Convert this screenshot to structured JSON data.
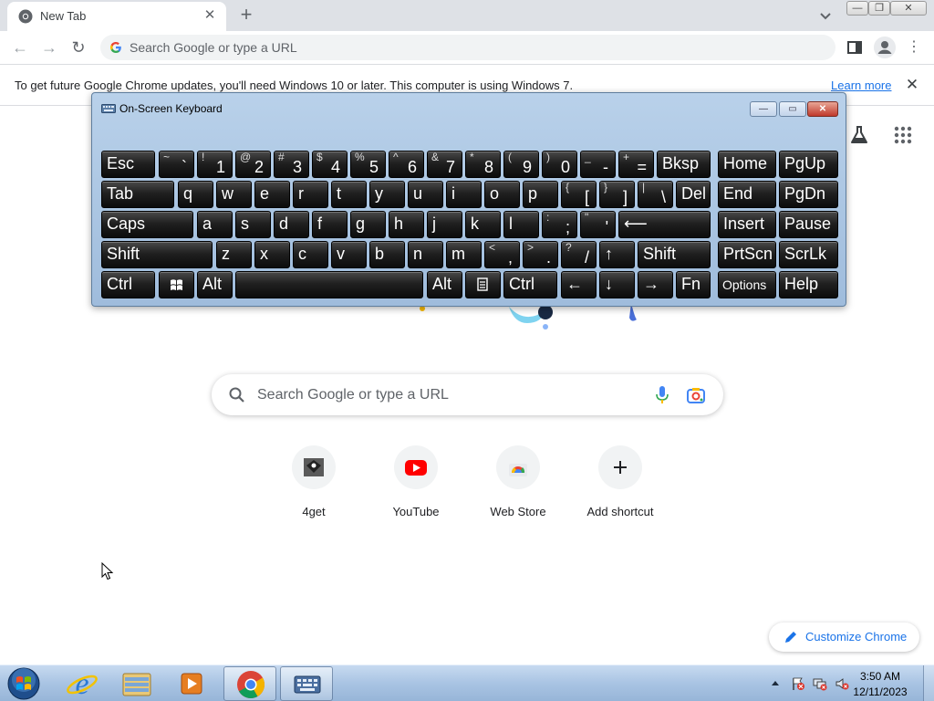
{
  "browser": {
    "tab_title": "New Tab",
    "omnibox_placeholder": "Search Google or type a URL"
  },
  "infobar": {
    "message": "To get future Google Chrome updates, you'll need Windows 10 or later. This computer is using Windows 7.",
    "link_label": "Learn more"
  },
  "ntp": {
    "search_placeholder": "Search Google or type a URL",
    "shortcuts": [
      {
        "label": "4get",
        "icon": "4get-icon"
      },
      {
        "label": "YouTube",
        "icon": "youtube-icon"
      },
      {
        "label": "Web Store",
        "icon": "web-store-icon"
      },
      {
        "label": "Add shortcut",
        "icon": "plus-icon"
      }
    ],
    "customize_label": "Customize Chrome"
  },
  "osk": {
    "title": "On-Screen Keyboard",
    "rows": [
      [
        {
          "main": "Esc"
        },
        {
          "shift": "~",
          "big": "`"
        },
        {
          "shift": "!",
          "big": "1"
        },
        {
          "shift": "@",
          "big": "2"
        },
        {
          "shift": "#",
          "big": "3"
        },
        {
          "shift": "$",
          "big": "4"
        },
        {
          "shift": "%",
          "big": "5"
        },
        {
          "shift": "^",
          "big": "6"
        },
        {
          "shift": "&",
          "big": "7"
        },
        {
          "shift": "*",
          "big": "8"
        },
        {
          "shift": "(",
          "big": "9"
        },
        {
          "shift": ")",
          "big": "0"
        },
        {
          "shift": "_",
          "big": "-"
        },
        {
          "shift": "+",
          "big": "="
        },
        {
          "main": "Bksp"
        },
        {
          "main": "Home"
        },
        {
          "main": "PgUp"
        }
      ],
      [
        {
          "main": "Tab"
        },
        {
          "main": "q"
        },
        {
          "main": "w"
        },
        {
          "main": "e"
        },
        {
          "main": "r"
        },
        {
          "main": "t"
        },
        {
          "main": "y"
        },
        {
          "main": "u"
        },
        {
          "main": "i"
        },
        {
          "main": "o"
        },
        {
          "main": "p"
        },
        {
          "shift": "{",
          "big": "["
        },
        {
          "shift": "}",
          "big": "]"
        },
        {
          "shift": "|",
          "big": "\\"
        },
        {
          "main": "Del"
        },
        {
          "main": "End"
        },
        {
          "main": "PgDn"
        }
      ],
      [
        {
          "main": "Caps"
        },
        {
          "main": "a"
        },
        {
          "main": "s"
        },
        {
          "main": "d"
        },
        {
          "main": "f"
        },
        {
          "main": "g"
        },
        {
          "main": "h"
        },
        {
          "main": "j"
        },
        {
          "main": "k"
        },
        {
          "main": "l"
        },
        {
          "shift": ":",
          "big": ";"
        },
        {
          "shift": "\"",
          "big": "'"
        },
        {
          "main": "⟵"
        },
        {
          "main": "Insert"
        },
        {
          "main": "Pause"
        }
      ],
      [
        {
          "main": "Shift"
        },
        {
          "main": "z"
        },
        {
          "main": "x"
        },
        {
          "main": "c"
        },
        {
          "main": "v"
        },
        {
          "main": "b"
        },
        {
          "main": "n"
        },
        {
          "main": "m"
        },
        {
          "shift": "<",
          "big": ","
        },
        {
          "shift": ">",
          "big": "."
        },
        {
          "shift": "?",
          "big": "/"
        },
        {
          "main": "↑"
        },
        {
          "main": "Shift"
        },
        {
          "main": "PrtScn"
        },
        {
          "main": "ScrLk"
        }
      ],
      [
        {
          "main": "Ctrl"
        },
        {
          "main": "",
          "icon": "windows-logo-icon"
        },
        {
          "main": "Alt"
        },
        {
          "main": ""
        },
        {
          "main": "Alt"
        },
        {
          "main": "",
          "icon": "context-menu-icon"
        },
        {
          "main": "Ctrl"
        },
        {
          "main": "←"
        },
        {
          "main": "↓"
        },
        {
          "main": "→"
        },
        {
          "main": "Fn"
        },
        {
          "opt": "Options"
        },
        {
          "main": "Help"
        }
      ]
    ]
  },
  "taskbar": {
    "apps": [
      "internet-explorer-icon",
      "windows-explorer-icon",
      "media-player-icon",
      "chrome-icon",
      "on-screen-keyboard-icon"
    ],
    "clock_time": "3:50 AM",
    "clock_date": "12/11/2023"
  }
}
